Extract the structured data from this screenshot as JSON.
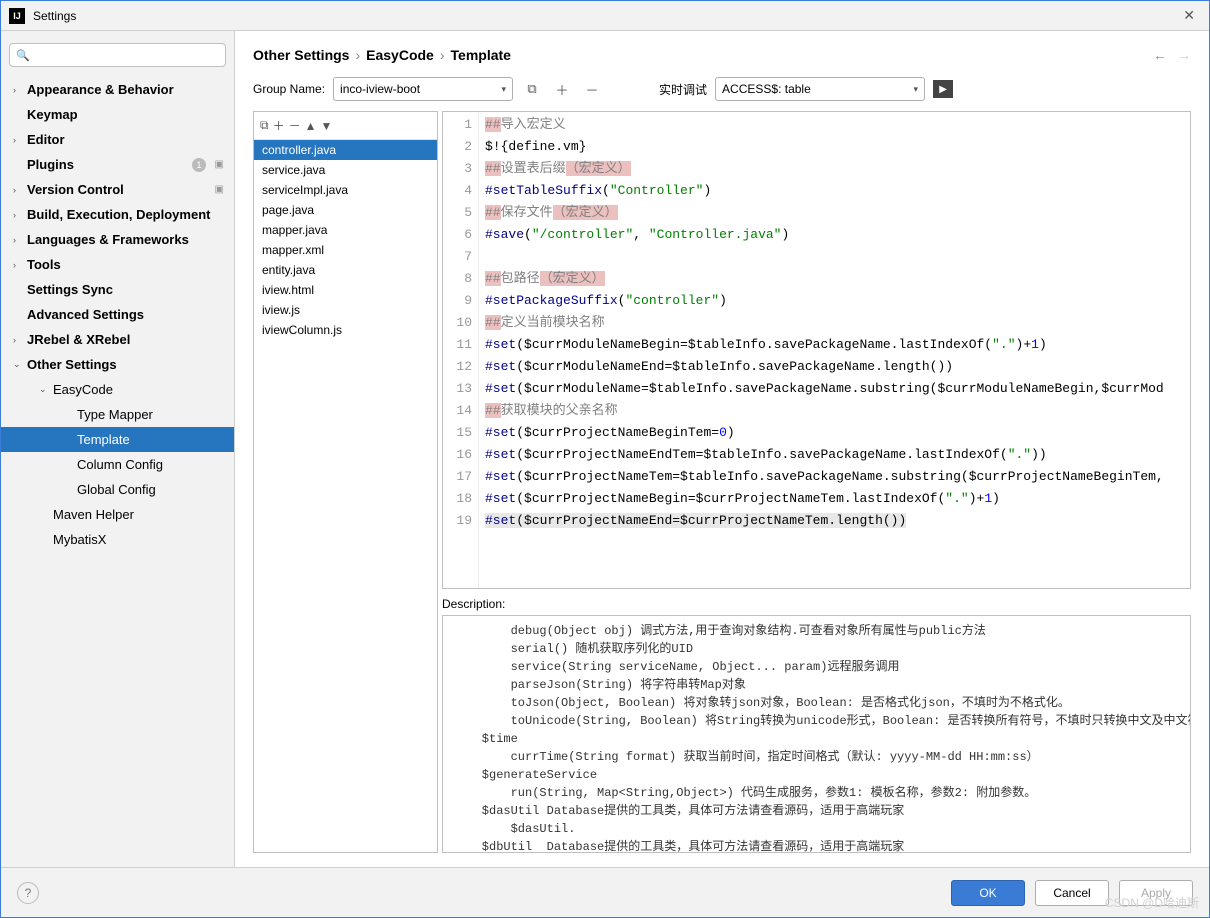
{
  "window": {
    "title": "Settings"
  },
  "sidebar": {
    "items": [
      {
        "label": "Appearance & Behavior",
        "bold": true,
        "chev": "›"
      },
      {
        "label": "Keymap",
        "bold": true
      },
      {
        "label": "Editor",
        "bold": true,
        "chev": "›"
      },
      {
        "label": "Plugins",
        "bold": true,
        "badge": "1",
        "square": true
      },
      {
        "label": "Version Control",
        "bold": true,
        "chev": "›",
        "square": true
      },
      {
        "label": "Build, Execution, Deployment",
        "bold": true,
        "chev": "›"
      },
      {
        "label": "Languages & Frameworks",
        "bold": true,
        "chev": "›"
      },
      {
        "label": "Tools",
        "bold": true,
        "chev": "›"
      },
      {
        "label": "Settings Sync",
        "bold": true
      },
      {
        "label": "Advanced Settings",
        "bold": true
      },
      {
        "label": "JRebel & XRebel",
        "bold": true,
        "chev": "›"
      },
      {
        "label": "Other Settings",
        "bold": true,
        "chev": "⌄"
      },
      {
        "label": "EasyCode",
        "depth": 1,
        "chev": "⌄"
      },
      {
        "label": "Type Mapper",
        "depth": 2
      },
      {
        "label": "Template",
        "depth": 2,
        "selected": true
      },
      {
        "label": "Column Config",
        "depth": 2
      },
      {
        "label": "Global Config",
        "depth": 2
      },
      {
        "label": "Maven Helper",
        "depth": 1
      },
      {
        "label": "MybatisX",
        "depth": 1
      }
    ]
  },
  "breadcrumbs": [
    "Other Settings",
    "EasyCode",
    "Template"
  ],
  "group": {
    "label": "Group Name:",
    "value": "inco-iview-boot"
  },
  "debug": {
    "label": "实时调试",
    "value": "ACCESS$: table"
  },
  "files": [
    "controller.java",
    "service.java",
    "serviceImpl.java",
    "page.java",
    "mapper.java",
    "mapper.xml",
    "entity.java",
    "iview.html",
    "iview.js",
    "iviewColumn.js"
  ],
  "selectedFile": 0,
  "editor": {
    "lines": [
      {
        "n": 1,
        "segs": [
          {
            "t": "##",
            "c": "c hl"
          },
          {
            "t": "导入宏定义",
            "c": "c"
          }
        ]
      },
      {
        "n": 2,
        "segs": [
          {
            "t": "$!{define.vm}",
            "c": ""
          }
        ]
      },
      {
        "n": 3,
        "segs": [
          {
            "t": "##",
            "c": "c hl"
          },
          {
            "t": "设置表后缀",
            "c": "c"
          },
          {
            "t": "（宏定义）",
            "c": "c hl"
          }
        ]
      },
      {
        "n": 4,
        "segs": [
          {
            "t": "#setTableSuffix",
            "c": "k"
          },
          {
            "t": "(",
            "c": ""
          },
          {
            "t": "\"Controller\"",
            "c": "s"
          },
          {
            "t": ")",
            "c": ""
          }
        ]
      },
      {
        "n": 5,
        "segs": [
          {
            "t": "##",
            "c": "c hl"
          },
          {
            "t": "保存文件",
            "c": "c"
          },
          {
            "t": "（宏定义）",
            "c": "c hl"
          }
        ]
      },
      {
        "n": 6,
        "segs": [
          {
            "t": "#save",
            "c": "k"
          },
          {
            "t": "(",
            "c": ""
          },
          {
            "t": "\"/controller\"",
            "c": "s"
          },
          {
            "t": ", ",
            "c": ""
          },
          {
            "t": "\"Controller.java\"",
            "c": "s"
          },
          {
            "t": ")",
            "c": ""
          }
        ]
      },
      {
        "n": 7,
        "segs": [
          {
            "t": "",
            "c": ""
          }
        ]
      },
      {
        "n": 8,
        "segs": [
          {
            "t": "##",
            "c": "c hl"
          },
          {
            "t": "包路径",
            "c": "c"
          },
          {
            "t": "（宏定义）",
            "c": "c hl"
          }
        ]
      },
      {
        "n": 9,
        "segs": [
          {
            "t": "#setPackageSuffix",
            "c": "k"
          },
          {
            "t": "(",
            "c": ""
          },
          {
            "t": "\"controller\"",
            "c": "s"
          },
          {
            "t": ")",
            "c": ""
          }
        ]
      },
      {
        "n": 10,
        "segs": [
          {
            "t": "##",
            "c": "c hl"
          },
          {
            "t": "定义当前模块名称",
            "c": "c"
          }
        ]
      },
      {
        "n": 11,
        "segs": [
          {
            "t": "#set",
            "c": "k"
          },
          {
            "t": "($currModuleNameBegin=$tableInfo.savePackageName.lastIndexOf(",
            "c": ""
          },
          {
            "t": "\".\"",
            "c": "s"
          },
          {
            "t": ")+",
            "c": ""
          },
          {
            "t": "1",
            "c": "n"
          },
          {
            "t": ")",
            "c": ""
          }
        ]
      },
      {
        "n": 12,
        "segs": [
          {
            "t": "#set",
            "c": "k"
          },
          {
            "t": "($currModuleNameEnd=$tableInfo.savePackageName.length())",
            "c": ""
          }
        ]
      },
      {
        "n": 13,
        "segs": [
          {
            "t": "#set",
            "c": "k"
          },
          {
            "t": "($currModuleName=$tableInfo.savePackageName.substring($currModuleNameBegin,$currMod",
            "c": ""
          }
        ]
      },
      {
        "n": 14,
        "segs": [
          {
            "t": "##",
            "c": "c hl"
          },
          {
            "t": "获取模块的父亲名称",
            "c": "c"
          }
        ]
      },
      {
        "n": 15,
        "segs": [
          {
            "t": "#set",
            "c": "k"
          },
          {
            "t": "($currProjectNameBeginTem=",
            "c": ""
          },
          {
            "t": "0",
            "c": "n"
          },
          {
            "t": ")",
            "c": ""
          }
        ]
      },
      {
        "n": 16,
        "segs": [
          {
            "t": "#set",
            "c": "k"
          },
          {
            "t": "($currProjectNameEndTem=$tableInfo.savePackageName.lastIndexOf(",
            "c": ""
          },
          {
            "t": "\".\"",
            "c": "s"
          },
          {
            "t": "))",
            "c": ""
          }
        ]
      },
      {
        "n": 17,
        "segs": [
          {
            "t": "#set",
            "c": "k"
          },
          {
            "t": "($currProjectNameTem=$tableInfo.savePackageName.substring($currProjectNameBeginTem,",
            "c": ""
          }
        ]
      },
      {
        "n": 18,
        "segs": [
          {
            "t": "#set",
            "c": "k"
          },
          {
            "t": "($currProjectNameBegin=$currProjectNameTem.lastIndexOf(",
            "c": ""
          },
          {
            "t": "\".\"",
            "c": "s"
          },
          {
            "t": ")+",
            "c": ""
          },
          {
            "t": "1",
            "c": "n"
          },
          {
            "t": ")",
            "c": ""
          }
        ]
      },
      {
        "n": 19,
        "segs": [
          {
            "t": "#set",
            "c": "k selline"
          },
          {
            "t": "($currProjectNameEnd=$currProjectNameTem.length())",
            "c": "selline"
          }
        ]
      }
    ]
  },
  "description": {
    "label": "Description:",
    "text": "        debug(Object obj) 调式方法,用于查询对象结构.可查看对象所有属性与public方法\n        serial() 随机获取序列化的UID\n        service(String serviceName, Object... param)远程服务调用\n        parseJson(String) 将字符串转Map对象\n        toJson(Object, Boolean) 将对象转json对象，Boolean: 是否格式化json，不填时为不格式化。\n        toUnicode(String, Boolean) 将String转换为unicode形式，Boolean: 是否转换所有符号，不填时只转换中文及中文符\n    $time\n        currTime(String format) 获取当前时间，指定时间格式（默认: yyyy-MM-dd HH:mm:ss）\n    $generateService\n        run(String, Map<String,Object>) 代码生成服务，参数1: 模板名称，参数2: 附加参数。\n    $dasUtil Database提供的工具类，具体可方法请查看源码，适用于高端玩家\n        $dasUtil.\n    $dbUtil  Database提供的工具类，具体可方法请查看源码，适用于高端玩家"
  },
  "buttons": {
    "ok": "OK",
    "cancel": "Cancel",
    "apply": "Apply"
  },
  "watermark": "CSDN @D哈迪斯"
}
